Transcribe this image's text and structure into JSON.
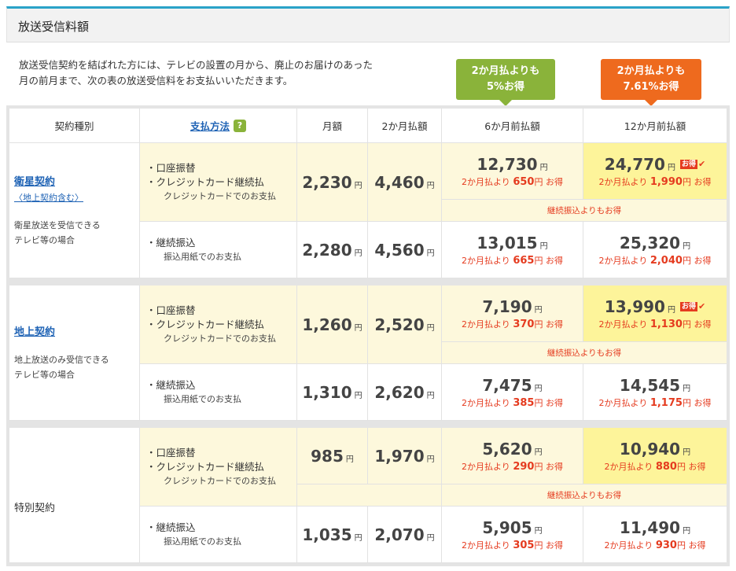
{
  "header": {
    "title": "放送受信料額"
  },
  "intro": {
    "line1": "放送受信契約を結ばれた方には、テレビの設置の月から、廃止のお届けのあった",
    "line2": "月の前月まで、次の表の放送受信料をお支払いいただきます。"
  },
  "bubbles": {
    "six": {
      "line1": "2か月払よりも",
      "line2": "5%お得",
      "color": "#8ab33a"
    },
    "twelve": {
      "line1": "2か月払よりも",
      "line2": "7.61%お得",
      "color": "#ee6a1e"
    }
  },
  "table_header": {
    "type": "契約種別",
    "method": "支払方法",
    "help": "?",
    "monthly": "月額",
    "two_month": "2か月払額",
    "six_month": "6か月前払額",
    "twelve_month": "12か月前払額"
  },
  "labels": {
    "yen": "円",
    "save_prefix": "2か月払より",
    "save_suffix": "お得",
    "badge": "お得",
    "check": "✔",
    "transfer_note": "継続振込よりもお得",
    "method_a1": "・口座振替",
    "method_a2": "・クレジットカード継続払",
    "method_a_sub": "クレジットカードでのお支払",
    "method_b1": "・継続振込",
    "method_b_sub": "振込用紙でのお支払"
  },
  "contracts": [
    {
      "name": "衛星契約",
      "sub": "〈地上契約含む〉",
      "desc1": "衛星放送を受信できる",
      "desc2": "テレビ等の場合",
      "a": {
        "monthly": "2,230",
        "two": "4,460",
        "six": "12,730",
        "six_save": "650",
        "twelve": "24,770",
        "twelve_save": "1,990"
      },
      "b": {
        "monthly": "2,280",
        "two": "4,560",
        "six": "13,015",
        "six_save": "665",
        "twelve": "25,320",
        "twelve_save": "2,040"
      }
    },
    {
      "name": "地上契約",
      "desc1": "地上放送のみ受信できる",
      "desc2": "テレビ等の場合",
      "a": {
        "monthly": "1,260",
        "two": "2,520",
        "six": "7,190",
        "six_save": "370",
        "twelve": "13,990",
        "twelve_save": "1,130"
      },
      "b": {
        "monthly": "1,310",
        "two": "2,620",
        "six": "7,475",
        "six_save": "385",
        "twelve": "14,545",
        "twelve_save": "1,175"
      }
    },
    {
      "name": "特別契約",
      "a": {
        "monthly": "985",
        "two": "1,970",
        "six": "5,620",
        "six_save": "290",
        "twelve": "10,940",
        "twelve_save": "880"
      },
      "b": {
        "monthly": "1,035",
        "two": "2,070",
        "six": "5,905",
        "six_save": "305",
        "twelve": "11,490",
        "twelve_save": "930"
      }
    }
  ]
}
